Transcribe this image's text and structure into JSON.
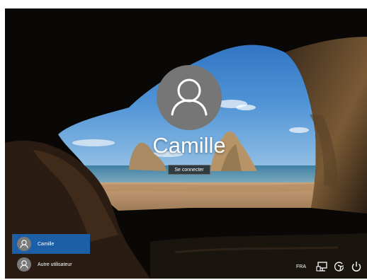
{
  "login": {
    "username": "Camille",
    "signin_label": "Se connecter"
  },
  "user_switcher": {
    "items": [
      {
        "label": "Camille",
        "selected": true
      },
      {
        "label": "Autre utilisateur",
        "selected": false
      }
    ]
  },
  "tray": {
    "language": "FRA",
    "icons": [
      "network-icon",
      "ease-of-access-icon",
      "power-icon"
    ]
  },
  "colors": {
    "selected_user": "#1d5fa6",
    "avatar": "#767676"
  }
}
